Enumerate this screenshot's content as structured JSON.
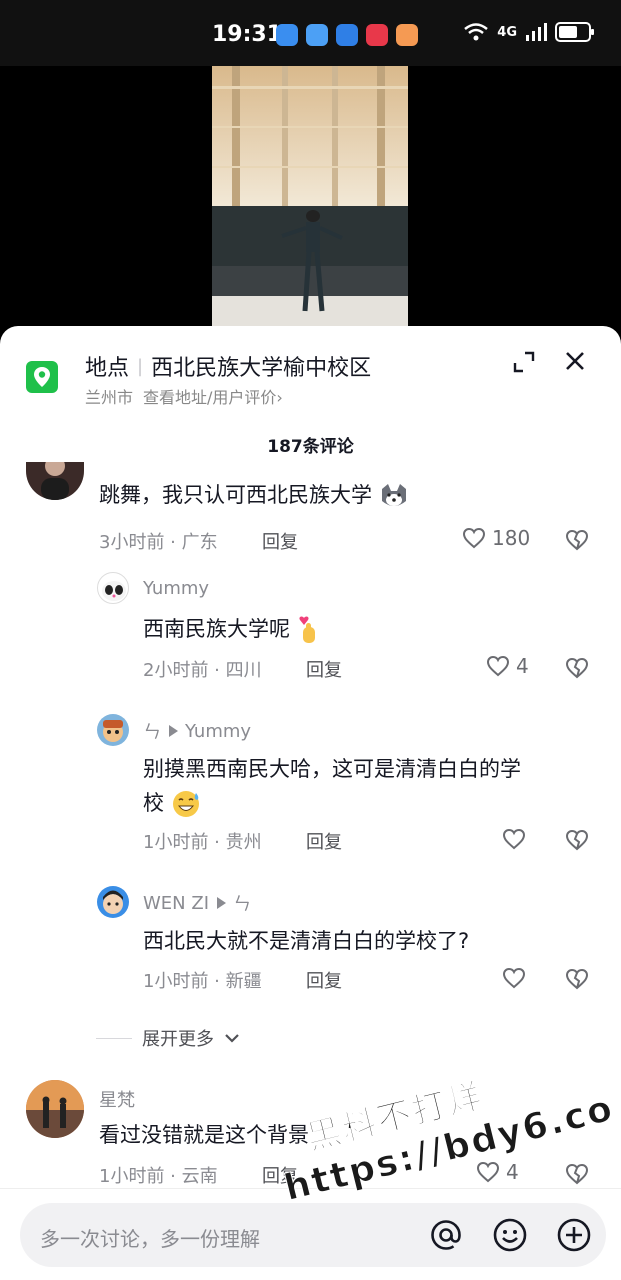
{
  "status_bar": {
    "time": "19:31",
    "network": "4G"
  },
  "location": {
    "label": "地点",
    "name": "西北民族大学榆中校区",
    "city": "兰州市",
    "link": "查看地址/用户评价",
    "chevron": "›"
  },
  "comment_count": "187条评论",
  "comments": [
    {
      "text": "跳舞，我只认可西北民族大学",
      "emoji": "husky-face-emoji",
      "time_loc": "3小时前 · 广东",
      "reply": "回复",
      "likes": "180"
    }
  ],
  "replies": [
    {
      "name": "Yummy",
      "text": "西南民族大学呢",
      "emoji": "finger-heart-emoji",
      "time_loc": "2小时前 · 四川",
      "reply": "回复",
      "likes": "4"
    },
    {
      "name": "ㄣ",
      "reply_to": "Yummy",
      "text_line1": "别摸黑西南民大哈，这可是清清白白的学",
      "text_line2": "校",
      "emoji": "sweat-smile-emoji",
      "time_loc": "1小时前 · 贵州",
      "reply": "回复",
      "likes": ""
    },
    {
      "name": "WEN ZI",
      "reply_to": "ㄣ",
      "text": "西北民大就不是清清白白的学校了?",
      "time_loc": "1小时前 · 新疆",
      "reply": "回复",
      "likes": ""
    }
  ],
  "expand_more": "展开更多",
  "comment2": {
    "name": "星梵",
    "text": "看过没错就是这个背景",
    "time_loc": "1小时前 · 云南",
    "reply": "回复",
    "likes": "4"
  },
  "input": {
    "placeholder": "多一次讨论，多一份理解"
  },
  "watermark": {
    "line1": "黑料不打烊",
    "line2": "https://bdy6.co"
  },
  "colors": {
    "location_green": "#1fc04a",
    "text_primary": "#161823",
    "text_secondary": "#8a8b91"
  }
}
